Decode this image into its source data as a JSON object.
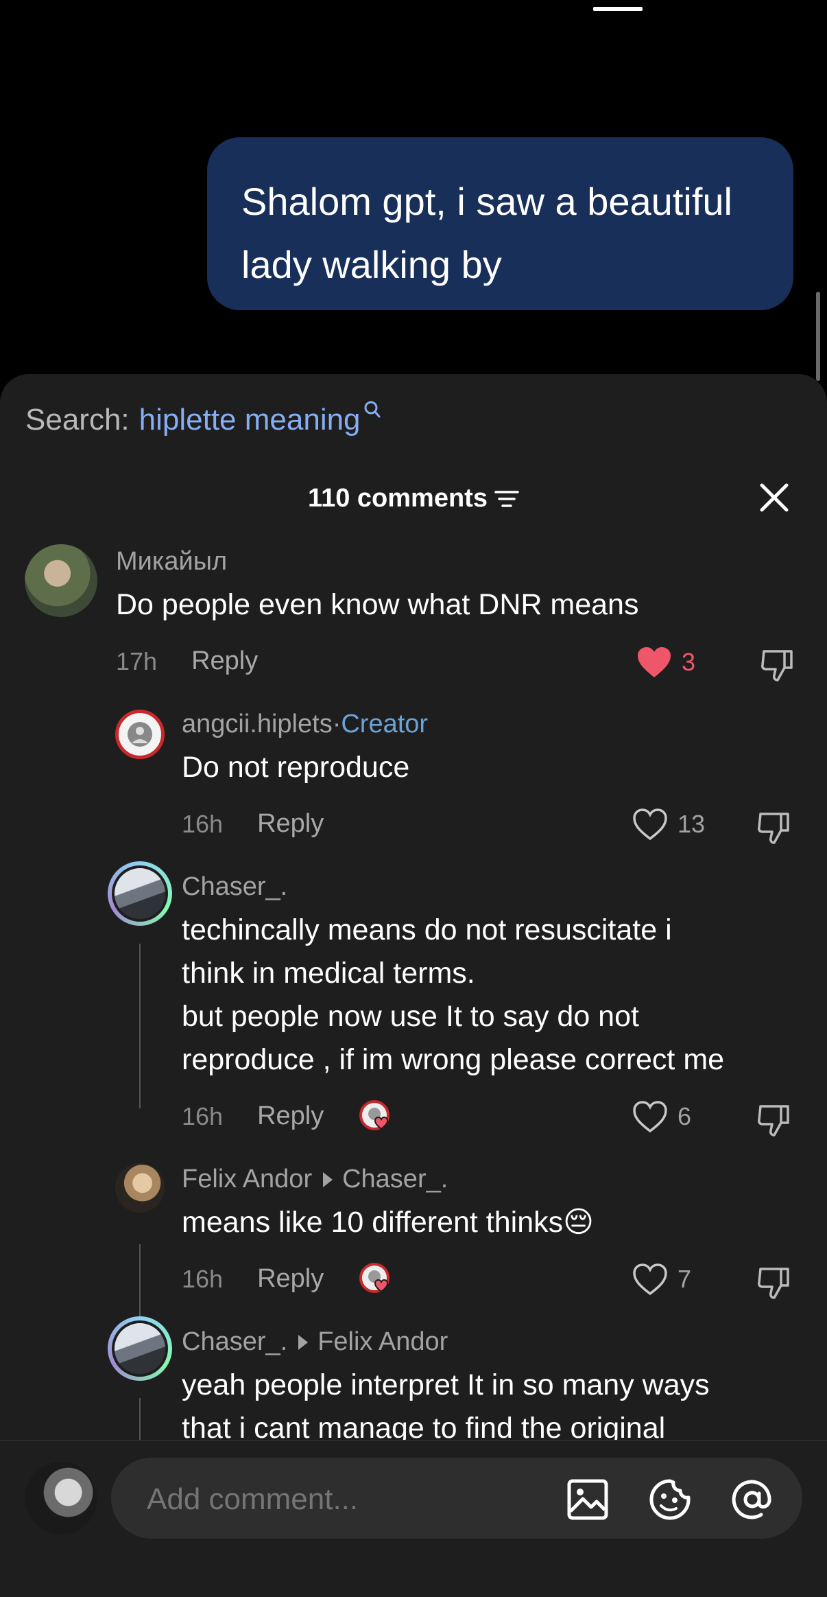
{
  "chat": {
    "message": "Shalom gpt, i saw a beautiful lady walking by"
  },
  "search": {
    "label": "Search:",
    "query": "hiplette meaning"
  },
  "header": {
    "count_label": "110 comments"
  },
  "comments": [
    {
      "user": "Микайыл",
      "text": "Do people even know what DNR means",
      "time": "17h",
      "reply": "Reply",
      "likes": "3"
    },
    {
      "user": "angcii.hiplets",
      "separator": " · ",
      "badge": "Creator",
      "text": "Do not reproduce",
      "time": "16h",
      "reply": "Reply",
      "likes": "13"
    },
    {
      "user": "Chaser_.",
      "text_lines": [
        "techincally means do not resuscitate i",
        "think in medical terms.",
        "but people now use It to say do not",
        "reproduce , if im wrong please correct me"
      ],
      "time": "16h",
      "reply": "Reply",
      "likes": "6"
    },
    {
      "user": "Felix Andor",
      "reply_to": "Chaser_.",
      "text": "means like 10 different thinks",
      "emoji": "😔",
      "time": "16h",
      "reply": "Reply",
      "likes": "7"
    },
    {
      "user": "Chaser_.",
      "reply_to": "Felix Andor",
      "text_lines": [
        "yeah people interpret It in so many ways",
        "that i cant manage to find the original"
      ]
    }
  ],
  "composer": {
    "placeholder": "Add comment..."
  },
  "icons": [
    "search-icon",
    "filter-icon",
    "close-icon",
    "heart-icon",
    "dislike-icon",
    "image-icon",
    "emoji-icon",
    "mention-icon"
  ],
  "colors": {
    "accent_link": "#86aef4",
    "creator": "#6aa3d8",
    "liked": "#f0566a",
    "bubble": "#182f5a",
    "sheet": "#1e1e1e"
  }
}
